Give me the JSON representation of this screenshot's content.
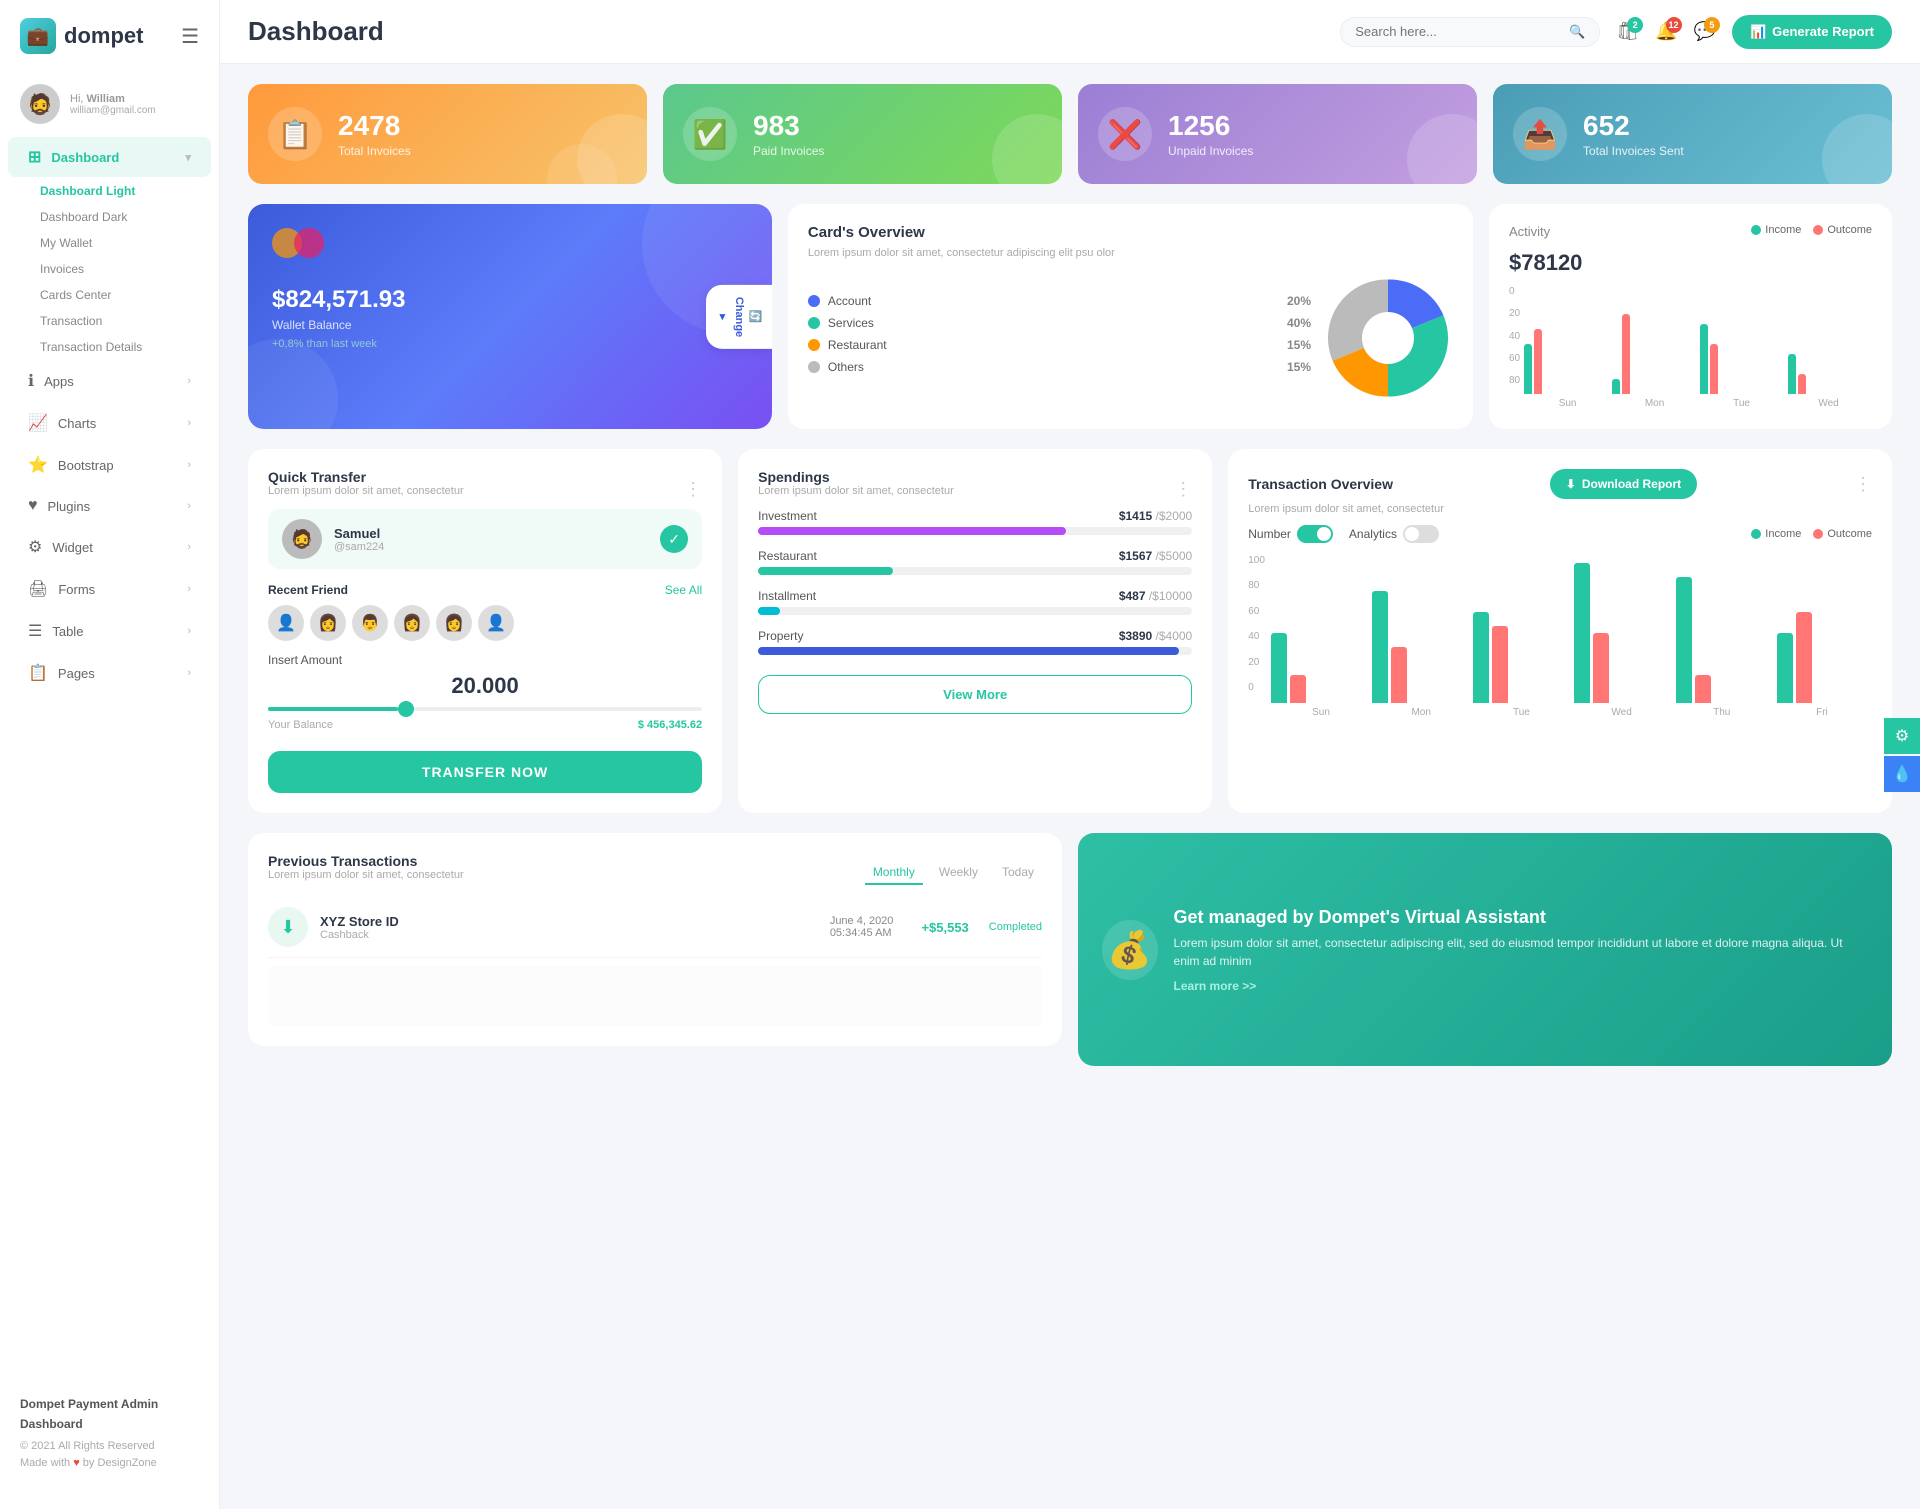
{
  "logo": {
    "text": "dompet"
  },
  "user": {
    "greeting": "Hi,",
    "name": "William",
    "email": "william@gmail.com"
  },
  "sidebar": {
    "dashboard_label": "Dashboard",
    "sub_items": [
      {
        "label": "Dashboard Light",
        "active": true
      },
      {
        "label": "Dashboard Dark",
        "active": false
      },
      {
        "label": "My Wallet",
        "active": false
      },
      {
        "label": "Invoices",
        "active": false
      },
      {
        "label": "Cards Center",
        "active": false
      },
      {
        "label": "Transaction",
        "active": false
      },
      {
        "label": "Transaction Details",
        "active": false
      }
    ],
    "nav_items": [
      {
        "label": "Apps",
        "icon": "ℹ"
      },
      {
        "label": "Charts",
        "icon": "📈"
      },
      {
        "label": "Bootstrap",
        "icon": "⭐"
      },
      {
        "label": "Plugins",
        "icon": "♥"
      },
      {
        "label": "Widget",
        "icon": "⚙"
      },
      {
        "label": "Forms",
        "icon": "🖨"
      },
      {
        "label": "Table",
        "icon": "☰"
      },
      {
        "label": "Pages",
        "icon": "📋"
      }
    ],
    "footer": {
      "title": "Dompet Payment Admin Dashboard",
      "copyright": "© 2021 All Rights Reserved",
      "made_with": "Made with",
      "by": "by DesignZone"
    }
  },
  "topbar": {
    "page_title": "Dashboard",
    "search_placeholder": "Search here...",
    "badge_cart": "2",
    "badge_notif": "12",
    "badge_msg": "5",
    "generate_btn": "Generate Report"
  },
  "stat_cards": [
    {
      "value": "2478",
      "label": "Total Invoices",
      "icon": "📋"
    },
    {
      "value": "983",
      "label": "Paid Invoices",
      "icon": "✅"
    },
    {
      "value": "1256",
      "label": "Unpaid Invoices",
      "icon": "❌"
    },
    {
      "value": "652",
      "label": "Total Invoices Sent",
      "icon": "📤"
    }
  ],
  "wallet": {
    "amount": "$824,571.93",
    "label": "Wallet Balance",
    "change": "+0,8% than last week",
    "change_btn": "Change"
  },
  "cards_overview": {
    "title": "Card's Overview",
    "subtitle": "Lorem ipsum dolor sit amet, consectetur adipiscing elit psu olor",
    "legend": [
      {
        "label": "Account",
        "value": "20%",
        "color": "#4a6cf7"
      },
      {
        "label": "Services",
        "value": "40%",
        "color": "#26c6a2"
      },
      {
        "label": "Restaurant",
        "value": "15%",
        "color": "#ff9800"
      },
      {
        "label": "Others",
        "value": "15%",
        "color": "#bbb"
      }
    ],
    "pie": [
      {
        "label": "Account",
        "pct": 20,
        "color": "#4a6cf7"
      },
      {
        "label": "Services",
        "pct": 40,
        "color": "#26c6a2"
      },
      {
        "label": "Restaurant",
        "pct": 15,
        "color": "#ff9800"
      },
      {
        "label": "Others",
        "pct": 15,
        "color": "#bbb"
      }
    ]
  },
  "activity": {
    "title": "Activity",
    "amount": "$78120",
    "income_label": "Income",
    "outcome_label": "Outcome",
    "income_color": "#26c6a2",
    "outcome_color": "#ff7675",
    "bars": [
      {
        "day": "Sun",
        "income": 50,
        "outcome": 65
      },
      {
        "day": "Mon",
        "income": 15,
        "outcome": 80
      },
      {
        "day": "Tue",
        "income": 70,
        "outcome": 50
      },
      {
        "day": "Wed",
        "income": 40,
        "outcome": 20
      }
    ]
  },
  "quick_transfer": {
    "title": "Quick Transfer",
    "subtitle": "Lorem ipsum dolor sit amet, consectetur",
    "contact": {
      "name": "Samuel",
      "id": "@sam224"
    },
    "recent_label": "Recent Friend",
    "see_all": "See All",
    "friends": [
      "👤",
      "👩",
      "👨",
      "👩",
      "👩",
      "👤"
    ],
    "amount_label": "Insert Amount",
    "amount": "20.000",
    "balance_label": "Your Balance",
    "balance": "$ 456,345.62",
    "transfer_btn": "TRANSFER NOW"
  },
  "spendings": {
    "title": "Spendings",
    "subtitle": "Lorem ipsum dolor sit amet, consectetur",
    "items": [
      {
        "label": "Investment",
        "current": "$1415",
        "max": "$2000",
        "pct": 71,
        "color": "#b44cf7"
      },
      {
        "label": "Restaurant",
        "current": "$1567",
        "max": "$5000",
        "pct": 31,
        "color": "#26c6a2"
      },
      {
        "label": "Installment",
        "current": "$487",
        "max": "$10000",
        "pct": 5,
        "color": "#00bcd4"
      },
      {
        "label": "Property",
        "current": "$3890",
        "max": "$4000",
        "pct": 97,
        "color": "#3b5bdb"
      }
    ],
    "view_more_btn": "View More"
  },
  "tx_overview": {
    "title": "Transaction Overview",
    "subtitle": "Lorem ipsum dolor sit amet, consectetur",
    "download_btn": "Download Report",
    "toggle_number": "Number",
    "toggle_analytics": "Analytics",
    "income_label": "Income",
    "outcome_label": "Outcome",
    "income_color": "#26c6a2",
    "outcome_color": "#ff7675",
    "bars": [
      {
        "day": "Sun",
        "income": 50,
        "outcome": 20
      },
      {
        "day": "Mon",
        "income": 80,
        "outcome": 40
      },
      {
        "day": "Tue",
        "income": 65,
        "outcome": 55
      },
      {
        "day": "Wed",
        "income": 100,
        "outcome": 50
      },
      {
        "day": "Thu",
        "income": 90,
        "outcome": 20
      },
      {
        "day": "Fri",
        "income": 50,
        "outcome": 65
      }
    ],
    "y_labels": [
      "0",
      "20",
      "40",
      "60",
      "80",
      "100"
    ]
  },
  "prev_transactions": {
    "title": "Previous Transactions",
    "subtitle": "Lorem ipsum dolor sit amet, consectetur",
    "tabs": [
      "Monthly",
      "Weekly",
      "Today"
    ],
    "active_tab": "Monthly",
    "rows": [
      {
        "name": "XYZ Store ID",
        "type": "Cashback",
        "date": "June 4, 2020",
        "time": "05:34:45 AM",
        "amount": "+$5,553",
        "status": "Completed"
      }
    ]
  },
  "va_banner": {
    "title": "Get managed by Dompet's Virtual Assistant",
    "text": "Lorem ipsum dolor sit amet, consectetur adipiscing elit, sed do eiusmod tempor incididunt ut labore et dolore magna aliqua. Ut enim ad minim",
    "link": "Learn more >>"
  }
}
